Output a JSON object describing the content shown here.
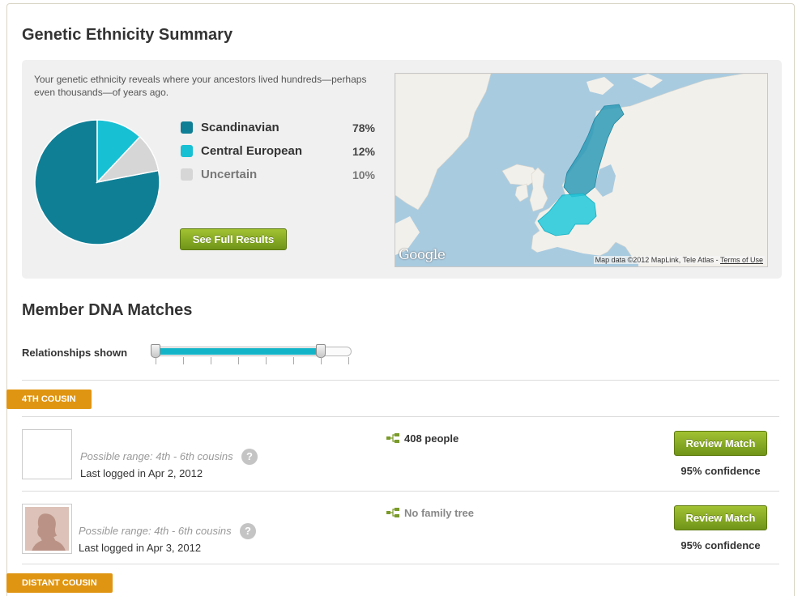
{
  "ethnicity": {
    "title": "Genetic Ethnicity Summary",
    "intro": "Your genetic ethnicity reveals where your ancestors lived hundreds—perhaps even thousands—of years ago.",
    "regions": [
      {
        "name": "Scandinavian",
        "percent_label": "78%",
        "value": 78,
        "color": "#0f7f96"
      },
      {
        "name": "Central European",
        "percent_label": "12%",
        "value": 12,
        "color": "#18c0d4"
      },
      {
        "name": "Uncertain",
        "percent_label": "10%",
        "value": 10,
        "color": "#d6d6d6"
      }
    ],
    "see_full_label": "See Full Results",
    "map": {
      "logo": "Google",
      "attribution": "Map data ©2012 MapLink, Tele Atlas - ",
      "terms_link": "Terms of Use"
    }
  },
  "matches": {
    "title": "Member DNA Matches",
    "relationships_label": "Relationships shown",
    "slider": {
      "min_step": 0,
      "max_step": 6,
      "steps_total": 7
    }
  },
  "categories": [
    {
      "label": "4TH COUSIN",
      "rows": [
        {
          "name": "",
          "range": "Possible range: 4th - 6th cousins",
          "help": "?",
          "last_login": "Last logged in Apr 2, 2012",
          "tree": "408 people",
          "review_label": "Review Match",
          "confidence": "95% confidence"
        },
        {
          "name": "",
          "range": "Possible range: 4th - 6th cousins",
          "help": "?",
          "last_login": "Last logged in Apr 3, 2012",
          "tree": "No family tree",
          "review_label": "Review Match",
          "confidence": "95% confidence"
        }
      ]
    },
    {
      "label": "DISTANT COUSIN"
    }
  ],
  "colors": {
    "accent_green": "#7fa21e",
    "badge_orange": "#e09512",
    "slider_teal": "#14b4c8",
    "tree_green": "#7a9a2a"
  }
}
